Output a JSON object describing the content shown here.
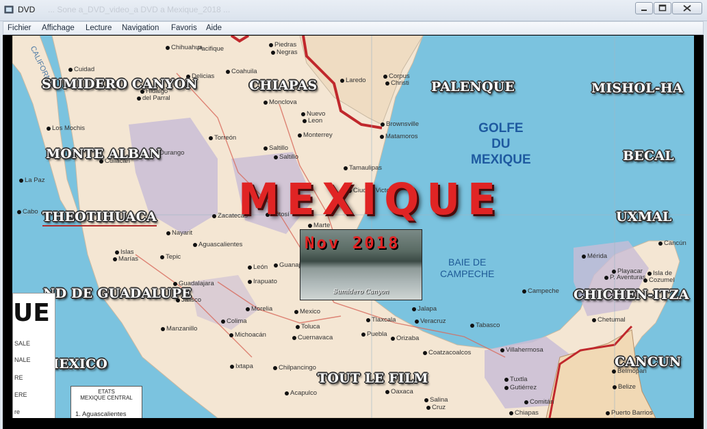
{
  "window": {
    "title": "DVD",
    "ghost_title": "...  Sone  a_DVD_video_a  DVD  a  Mexique_2018  ..."
  },
  "menu": [
    "Fichier",
    "Affichage",
    "Lecture",
    "Navigation",
    "Favoris",
    "Aide"
  ],
  "dvd_menu": {
    "title": "MEXIQUE",
    "date": "Nov 2018",
    "thumbnail_caption": "Sumidero Canyon",
    "chapters": [
      "SUMIDERO CANYON",
      "CHIAPAS",
      "PALENQUE",
      "MISHOL-HA",
      "MONTE ALBAN",
      "BECAL",
      "THEOTIHUACA",
      "UXMAL",
      "ND DE GUADALUPE",
      "CHICHEN-ITZA",
      "MEXICO",
      "CANCUN",
      "TOUT LE FILM"
    ],
    "selected_chapter": "THEOTIHUACA"
  },
  "map": {
    "gulf_label": [
      "GOLFE",
      "DU",
      "MEXIQUE"
    ],
    "bay_label": [
      "BAIE DE",
      "CAMPECHE"
    ],
    "cities": [
      "Chihuahua",
      "Cuidad",
      "Delicias",
      "Hidalgo",
      "del Parral",
      "Los Mochis",
      "Culiacan",
      "Durango",
      "La Paz",
      "Cabo",
      "Nayarit",
      "Islas",
      "Marías",
      "Tepic",
      "Zacatecas",
      "Aguascalientes",
      "León",
      "Irapuato",
      "Guanaj",
      "Guadalajara",
      "Jalisco",
      "Morelia",
      "Colima",
      "Manzanillo",
      "Michoacán",
      "Ixtapa",
      "Chilpancingo",
      "Acapulco",
      "Oaxaca",
      "Mexico",
      "Toluca",
      "Cuernavaca",
      "Tlaxcala",
      "Puebla",
      "Orizaba",
      "Jalapa",
      "Veracruz",
      "Tabasco",
      "Coatzacoalcos",
      "Villahermosa",
      "Tuxtla",
      "Gutiérrez",
      "Comitán",
      "Chiapas",
      "Salina",
      "Cruz",
      "Mérida",
      "Playacar",
      "P. Aventuras",
      "Isla de",
      "Cozumel",
      "Campeche",
      "Chetumal",
      "Belmopan",
      "Belize",
      "Puerto Barrios",
      "Cancún",
      "Piedras",
      "Negras",
      "Coahuila",
      "Monclova",
      "Torreón",
      "Saltillo",
      "Monterrey",
      "Nuevo",
      "Leon",
      "Laredo",
      "Corpus",
      "Christi",
      "Brownsville",
      "Matamoros",
      "Tamaulipas",
      "Ciudad Victoria",
      "Potosí",
      "Marte",
      "Saltillo",
      "Pacifique",
      "CALIFORNIE"
    ]
  },
  "legend": {
    "big_text": "UE",
    "lines": [
      "SALE",
      "NALE",
      "RE",
      "ERE",
      "re"
    ],
    "state_box_title": [
      "ETATS",
      "MEXIQUE CENTRAL"
    ],
    "state_line": "1. Aguascalientes"
  },
  "colors": {
    "sea": "#7bc3df",
    "land": "#f4e6d3",
    "state_highlight": "#c9bdd6",
    "title_red": "#e02424",
    "border_red": "#c0282c"
  }
}
